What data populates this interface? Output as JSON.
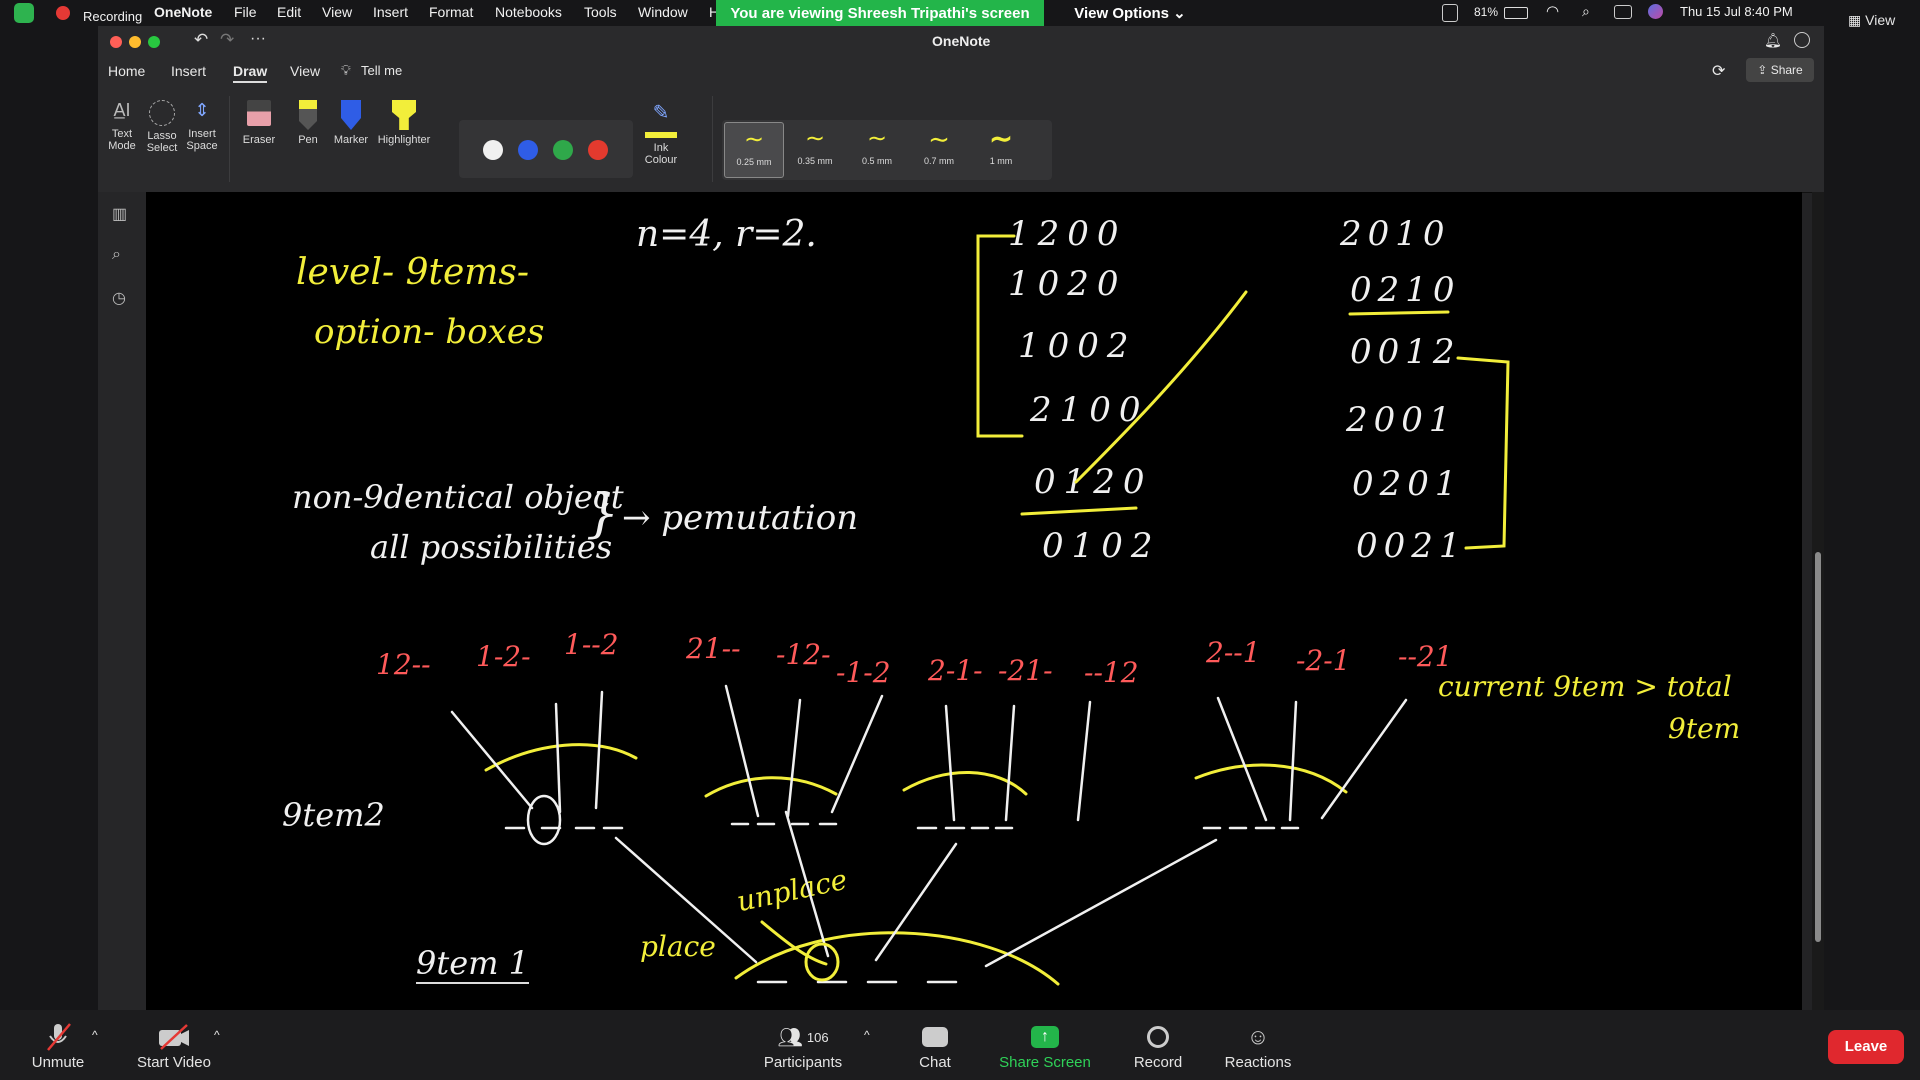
{
  "menubar": {
    "recording": "Recording",
    "app": "OneNote",
    "items": [
      "File",
      "Edit",
      "View",
      "Insert",
      "Format",
      "Notebooks",
      "Tools",
      "Window",
      "H"
    ],
    "banner": "You are viewing Shreesh Tripathi's screen",
    "view_options": "View Options",
    "battery": "81%",
    "datetime": "Thu 15 Jul  8:40 PM",
    "view_right": "View"
  },
  "window": {
    "title": "OneNote",
    "tabs": [
      "Home",
      "Insert",
      "Draw",
      "View"
    ],
    "active_tab": "Draw",
    "tell_me": "Tell me",
    "share": "Share"
  },
  "ribbon": {
    "text_mode": [
      "Text",
      "Mode"
    ],
    "lasso_select": [
      "Lasso",
      "Select"
    ],
    "insert_space": [
      "Insert",
      "Space"
    ],
    "eraser": "Eraser",
    "pen": "Pen",
    "marker": "Marker",
    "highlighter": "Highlighter",
    "ink_colour": [
      "Ink",
      "Colour"
    ],
    "colors": [
      "#f0f0f0",
      "#2f5de6",
      "#2fa84a",
      "#e43a2e"
    ],
    "thickness": [
      "0.25 mm",
      "0.35 mm",
      "0.5 mm",
      "0.7 mm",
      "1 mm"
    ]
  },
  "notes": {
    "header": "n=4,  r=2.",
    "level": "level- 9tems-",
    "option": "option- boxes",
    "non_identical": "non-9dentical object",
    "all_poss": "all possibilities",
    "arrow_perm": "→ pemutation",
    "col1": [
      "1200",
      "1020",
      "1002",
      "2100",
      "0120",
      "0102"
    ],
    "col2": [
      "2010",
      "0210",
      "0012",
      "2001",
      "0201",
      "0021"
    ],
    "perms": [
      "12--",
      "1-2-",
      "1--2",
      "21--",
      "-12-",
      "-1-2",
      "2-1-",
      "-21-",
      "--12",
      "2--1",
      "-2-1",
      "--21"
    ],
    "current_item": "current 9tem > total",
    "item_word": "9tem",
    "item2": "9tem2",
    "item1": "9tem 1",
    "place": "place",
    "unplace": "unplace"
  },
  "zoom": {
    "unmute": "Unmute",
    "start_video": "Start Video",
    "participants": "Participants",
    "participants_count": "106",
    "chat": "Chat",
    "share_screen": "Share Screen",
    "record": "Record",
    "reactions": "Reactions",
    "leave": "Leave"
  }
}
